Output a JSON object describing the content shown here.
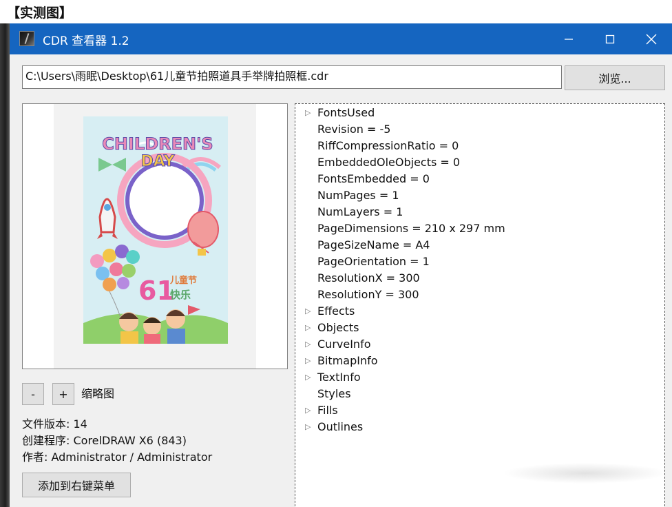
{
  "caption": "【实测图】",
  "window": {
    "title": "CDR 查看器 1.2",
    "icons": {
      "app": "app-icon",
      "minimize": "minimize-icon",
      "maximize": "maximize-icon",
      "close": "close-icon"
    }
  },
  "path": {
    "value": "C:\\Users\\雨眠\\Desktop\\61儿童节拍照道具手举牌拍照框.cdr"
  },
  "browse_label": "浏览...",
  "preview": {
    "poster_title": "CHILDREN'S",
    "poster_subtitle": "DAY",
    "poster_number": "61",
    "poster_text1": "儿童节",
    "poster_text2": "快乐",
    "colors": {
      "background": "#d7eef3",
      "frame_outer": "#f6a5c0",
      "frame_inner": "#7a62c9",
      "grass": "#8fcf6a"
    }
  },
  "zoom": {
    "minus": "-",
    "plus": "+",
    "label": "缩略图"
  },
  "info": {
    "version": "文件版本: 14",
    "creator": "创建程序: CorelDRAW X6 (843)",
    "author": "作者: Administrator / Administrator"
  },
  "context_menu_button": "添加到右键菜单",
  "tree": [
    {
      "label": "FontsUsed",
      "expandable": true
    },
    {
      "label": "Revision = -5",
      "expandable": false
    },
    {
      "label": "RiffCompressionRatio = 0",
      "expandable": false
    },
    {
      "label": "EmbeddedOleObjects = 0",
      "expandable": false
    },
    {
      "label": "FontsEmbedded = 0",
      "expandable": false
    },
    {
      "label": "NumPages = 1",
      "expandable": false
    },
    {
      "label": "NumLayers = 1",
      "expandable": false
    },
    {
      "label": "PageDimensions = 210 x 297 mm",
      "expandable": false
    },
    {
      "label": "PageSizeName = A4",
      "expandable": false
    },
    {
      "label": "PageOrientation = 1",
      "expandable": false
    },
    {
      "label": "ResolutionX = 300",
      "expandable": false
    },
    {
      "label": "ResolutionY = 300",
      "expandable": false
    },
    {
      "label": "Effects",
      "expandable": true
    },
    {
      "label": "Objects",
      "expandable": true
    },
    {
      "label": "CurveInfo",
      "expandable": true
    },
    {
      "label": "BitmapInfo",
      "expandable": true
    },
    {
      "label": "TextInfo",
      "expandable": true
    },
    {
      "label": "Styles",
      "expandable": false
    },
    {
      "label": "Fills",
      "expandable": true
    },
    {
      "label": "Outlines",
      "expandable": true
    }
  ],
  "colors": {
    "titlebar": "#1565c0",
    "window_bg": "#f0f0f0",
    "button_bg": "#e1e1e1"
  }
}
